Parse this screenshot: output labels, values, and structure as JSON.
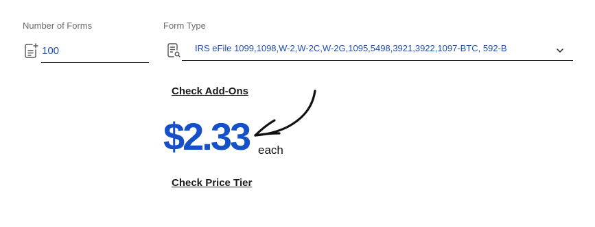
{
  "form": {
    "num_forms_label": "Number of Forms",
    "num_forms_value": "100",
    "form_type_label": "Form Type",
    "form_type_value": "IRS eFile 1099,1098,W-2,W-2C,W-2G,1095,5498,3921,3922,1097-BTC, 592-B"
  },
  "links": {
    "check_addons": "Check Add-Ons",
    "check_price_tier": "Check Price Tier"
  },
  "pricing": {
    "price": "$2.33",
    "unit": "each"
  },
  "icons": {
    "num_forms_icon": "document-plus-icon",
    "form_type_icon": "document-search-icon",
    "dropdown_icon": "chevron-down-icon",
    "annotation": "hand-drawn-arrow-icon"
  },
  "colors": {
    "accent": "#1550c8",
    "value_text": "#1d4fae"
  }
}
